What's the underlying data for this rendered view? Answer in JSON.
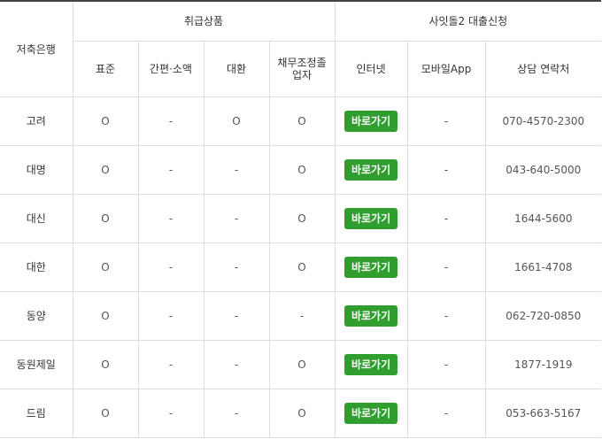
{
  "headers": {
    "bank": "저축은행",
    "products_group": "취급상품",
    "channels_group": "사잇돌2 대출신청",
    "standard": "표준",
    "simplified": "간편·소액",
    "refinance": "대환",
    "debt_adjust": "채무조정졸업자",
    "internet": "인터넷",
    "mobile_app": "모바일App",
    "contact": "상담 연락처"
  },
  "rows": [
    {
      "bank": "고려",
      "standard": "O",
      "simplified": "-",
      "refinance": "O",
      "debt_adjust": "O",
      "internet": "바로가기",
      "mobile_app": "-",
      "contact": "070-4570-2300"
    },
    {
      "bank": "대명",
      "standard": "O",
      "simplified": "-",
      "refinance": "-",
      "debt_adjust": "O",
      "internet": "바로가기",
      "mobile_app": "-",
      "contact": "043-640-5000"
    },
    {
      "bank": "대신",
      "standard": "O",
      "simplified": "-",
      "refinance": "-",
      "debt_adjust": "O",
      "internet": "바로가기",
      "mobile_app": "-",
      "contact": "1644-5600"
    },
    {
      "bank": "대한",
      "standard": "O",
      "simplified": "-",
      "refinance": "-",
      "debt_adjust": "O",
      "internet": "바로가기",
      "mobile_app": "-",
      "contact": "1661-4708"
    },
    {
      "bank": "동양",
      "standard": "O",
      "simplified": "-",
      "refinance": "-",
      "debt_adjust": "-",
      "internet": "바로가기",
      "mobile_app": "-",
      "contact": "062-720-0850"
    },
    {
      "bank": "동원제일",
      "standard": "O",
      "simplified": "-",
      "refinance": "-",
      "debt_adjust": "O",
      "internet": "바로가기",
      "mobile_app": "-",
      "contact": "1877-1919"
    },
    {
      "bank": "드림",
      "standard": "O",
      "simplified": "-",
      "refinance": "-",
      "debt_adjust": "O",
      "internet": "바로가기",
      "mobile_app": "-",
      "contact": "053-663-5167"
    }
  ],
  "colors": {
    "button_green": "#2f9e2f",
    "header_border": "#444444",
    "grid_line": "#dddddd"
  }
}
